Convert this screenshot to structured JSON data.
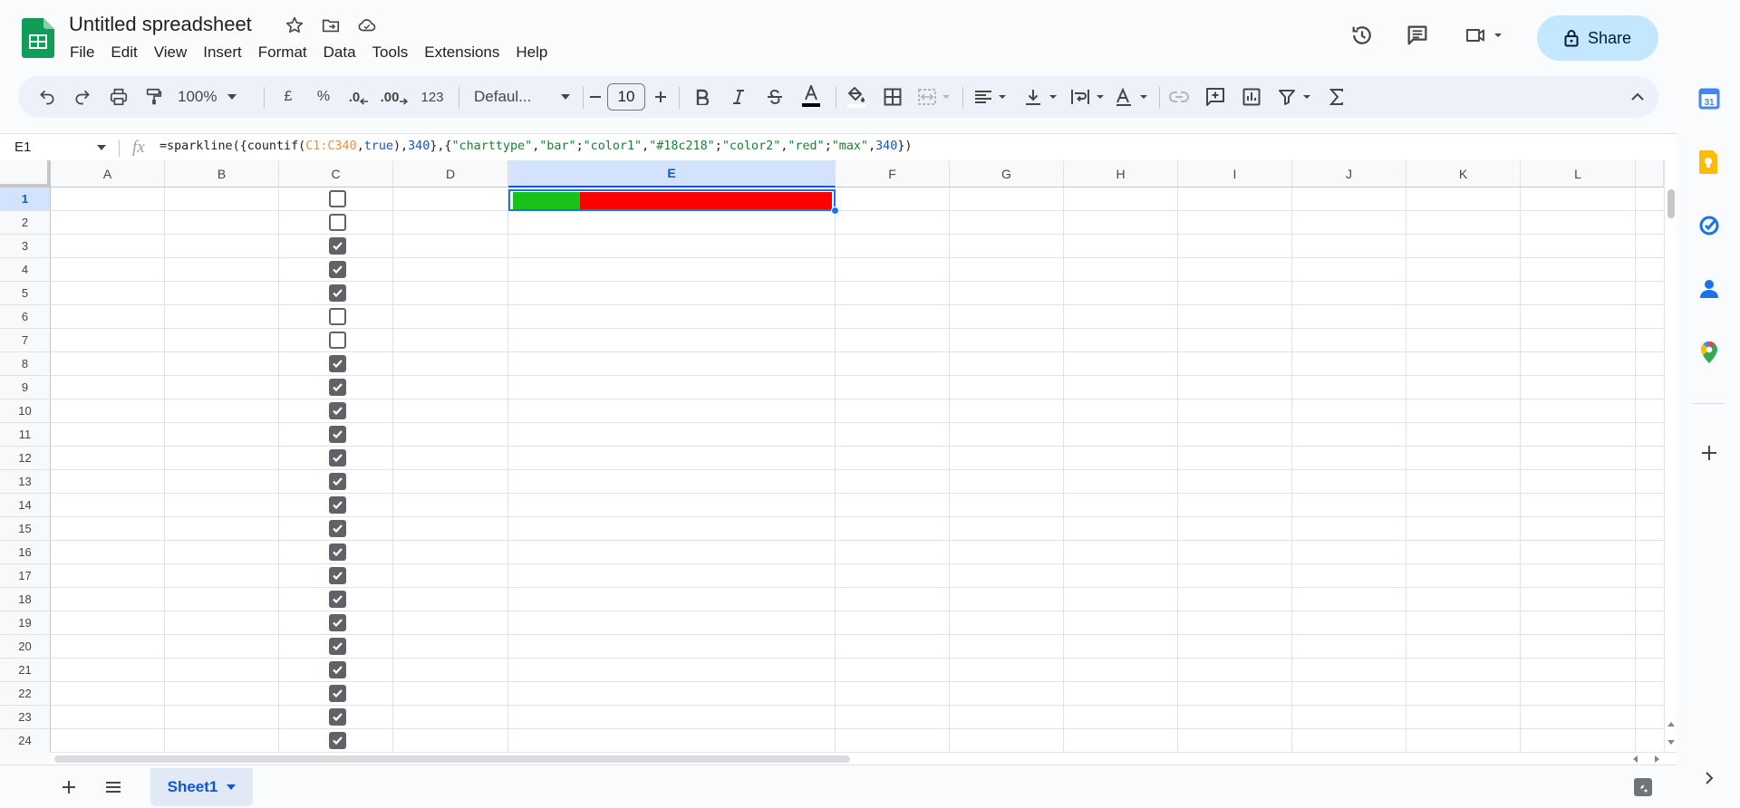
{
  "doc": {
    "title": "Untitled spreadsheet"
  },
  "menu": [
    "File",
    "Edit",
    "View",
    "Insert",
    "Format",
    "Data",
    "Tools",
    "Extensions",
    "Help"
  ],
  "share": {
    "label": "Share"
  },
  "toolbar": {
    "zoom": "100%",
    "currency": "£",
    "percent": "%",
    "dec_decrease": ".0",
    "dec_increase": ".00",
    "more_formats": "123",
    "font": "Defaul...",
    "font_size": "10"
  },
  "formula_bar": {
    "cell_ref": "E1",
    "fx": "fx",
    "formula": "=sparkline({countif(C1:C340,true),340},{\"charttype\",\"bar\";\"color1\",\"#18c218\";\"color2\",\"red\";\"max\",340})"
  },
  "grid": {
    "columns": [
      "A",
      "B",
      "C",
      "D",
      "E",
      "F",
      "G",
      "H",
      "I",
      "J",
      "K",
      "L"
    ],
    "selected_column": "E",
    "rows": [
      "1",
      "2",
      "3",
      "4",
      "5",
      "6",
      "7",
      "8",
      "9",
      "10",
      "11",
      "12",
      "13",
      "14",
      "15",
      "16",
      "17",
      "18",
      "19",
      "20",
      "21",
      "22",
      "23",
      "24"
    ],
    "selected_row": "1",
    "column_c_checked": [
      false,
      false,
      true,
      true,
      true,
      false,
      false,
      true,
      true,
      true,
      true,
      true,
      true,
      true,
      true,
      true,
      true,
      true,
      true,
      true,
      true,
      true,
      true,
      true
    ]
  },
  "sparkline": {
    "green_fraction": 0.21,
    "color1": "#18c218",
    "color2": "red"
  },
  "sheet_tab": {
    "label": "Sheet1"
  }
}
